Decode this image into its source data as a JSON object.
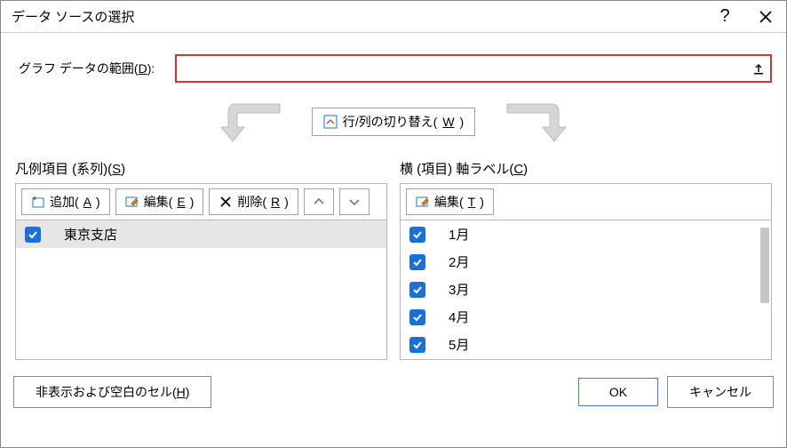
{
  "title": "データ ソースの選択",
  "range": {
    "label_pre": "グラフ データの範囲(",
    "label_key": "D",
    "label_post": "):",
    "value": ""
  },
  "switch": {
    "label_pre": "行/列の切り替え(",
    "label_key": "W",
    "label_post": ")"
  },
  "left": {
    "title_pre": "凡例項目 (系列)(",
    "title_key": "S",
    "title_post": ")",
    "add_pre": "追加(",
    "add_key": "A",
    "add_post": ")",
    "edit_pre": "編集(",
    "edit_key": "E",
    "edit_post": ")",
    "del_pre": "削除(",
    "del_key": "R",
    "del_post": ")",
    "items": [
      {
        "label": "東京支店",
        "checked": true,
        "selected": true
      }
    ]
  },
  "right": {
    "title_pre": "横 (項目) 軸ラベル(",
    "title_key": "C",
    "title_post": ")",
    "edit_pre": "編集(",
    "edit_key": "T",
    "edit_post": ")",
    "items": [
      {
        "label": "1月",
        "checked": true
      },
      {
        "label": "2月",
        "checked": true
      },
      {
        "label": "3月",
        "checked": true
      },
      {
        "label": "4月",
        "checked": true
      },
      {
        "label": "5月",
        "checked": true
      }
    ]
  },
  "footer": {
    "hidden_pre": "非表示および空白のセル(",
    "hidden_key": "H",
    "hidden_post": ")",
    "ok": "OK",
    "cancel": "キャンセル"
  }
}
